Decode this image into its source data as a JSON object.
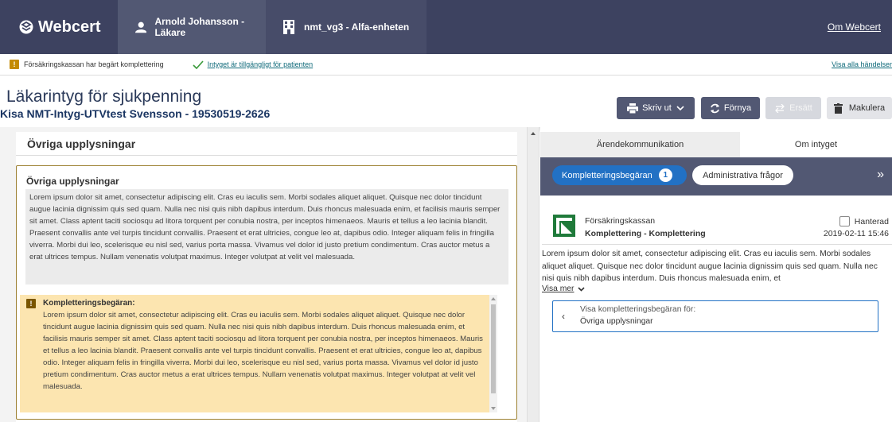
{
  "topbar": {
    "brand": "Webcert",
    "user": "Arnold Johansson - Läkare",
    "unit": "nmt_vg3 - Alfa-enheten",
    "about_link": "Om Webcert"
  },
  "statusbar": {
    "warning": "Försäkringskassan har begärt komplettering",
    "available": "Intyget är tillgängligt för patienten",
    "all_events": "Visa alla händelser"
  },
  "header": {
    "title": "Läkarintyg för sjukpenning",
    "patient": "Kisa NMT-Intyg-UTVtest Svensson - 19530519-2626",
    "buttons": {
      "print": "Skriv ut",
      "renew": "Förnya",
      "replace": "Ersätt",
      "void": "Makulera"
    }
  },
  "left": {
    "section_title": "Övriga upplysningar",
    "box_title": "Övriga upplysningar",
    "text": "Lorem ipsum dolor sit amet, consectetur adipiscing elit. Cras eu iaculis sem. Morbi sodales aliquet aliquet. Quisque nec dolor tincidunt augue lacinia dignissim quis sed quam. Nulla nec nisi quis nibh dapibus interdum. Duis rhoncus malesuada enim, et facilisis mauris semper sit amet. Class aptent taciti sociosqu ad litora torquent per conubia nostra, per inceptos himenaeos. Mauris et tellus a leo lacinia blandit. Praesent convallis ante vel turpis tincidunt convallis. Praesent et erat ultricies, congue leo at, dapibus odio. Integer aliquam felis in fringilla viverra. Morbi dui leo, scelerisque eu nisl sed, varius porta massa. Vivamus vel dolor id justo pretium condimentum. Cras auctor metus a erat ultrices tempus. Nullam venenatis volutpat maximus. Integer volutpat at velit vel malesuada.",
    "complement_title": "Kompletteringsbegäran:",
    "complement_text": "Lorem ipsum dolor sit amet, consectetur adipiscing elit. Cras eu iaculis sem. Morbi sodales aliquet aliquet. Quisque nec dolor tincidunt augue lacinia dignissim quis sed quam. Nulla nec nisi quis nibh dapibus interdum. Duis rhoncus malesuada enim, et facilisis mauris semper sit amet. Class aptent taciti sociosqu ad litora torquent per conubia nostra, per inceptos himenaeos. Mauris et tellus a leo lacinia blandit. Praesent convallis ante vel turpis tincidunt convallis. Praesent et erat ultricies, congue leo at, dapibus odio. Integer aliquam felis in fringilla viverra. Morbi dui leo, scelerisque eu nisl sed, varius porta massa. Vivamus vel dolor id justo pretium condimentum. Cras auctor metus a erat ultrices tempus. Nullam venenatis volutpat maximus. Integer volutpat at velit vel malesuada."
  },
  "right": {
    "tabs": [
      "Ärendekommunikation",
      "Om intyget"
    ],
    "pill_active": "Kompletteringsbegäran",
    "pill_count": "1",
    "pill_inactive": "Administrativa frågor",
    "message": {
      "sender": "Försäkringskassan",
      "subject": "Komplettering - Komplettering",
      "handled_label": "Hanterad",
      "date": "2019-02-11 15:46",
      "body": "Lorem ipsum dolor sit amet, consectetur adipiscing elit. Cras eu iaculis sem. Morbi sodales aliquet aliquet. Quisque nec dolor tincidunt augue lacinia dignissim quis sed quam. Nulla nec nisi quis nibh dapibus interdum. Duis rhoncus malesuada enim, et",
      "show_more": "Visa mer",
      "ref_line1": "Visa kompletteringsbegäran för:",
      "ref_line2": "Övriga upplysningar"
    }
  },
  "colors": {
    "topbar": "#3d4260",
    "accent_blue": "#2271c4",
    "warning": "#c48a00",
    "complement_bg": "#fce5b0"
  }
}
